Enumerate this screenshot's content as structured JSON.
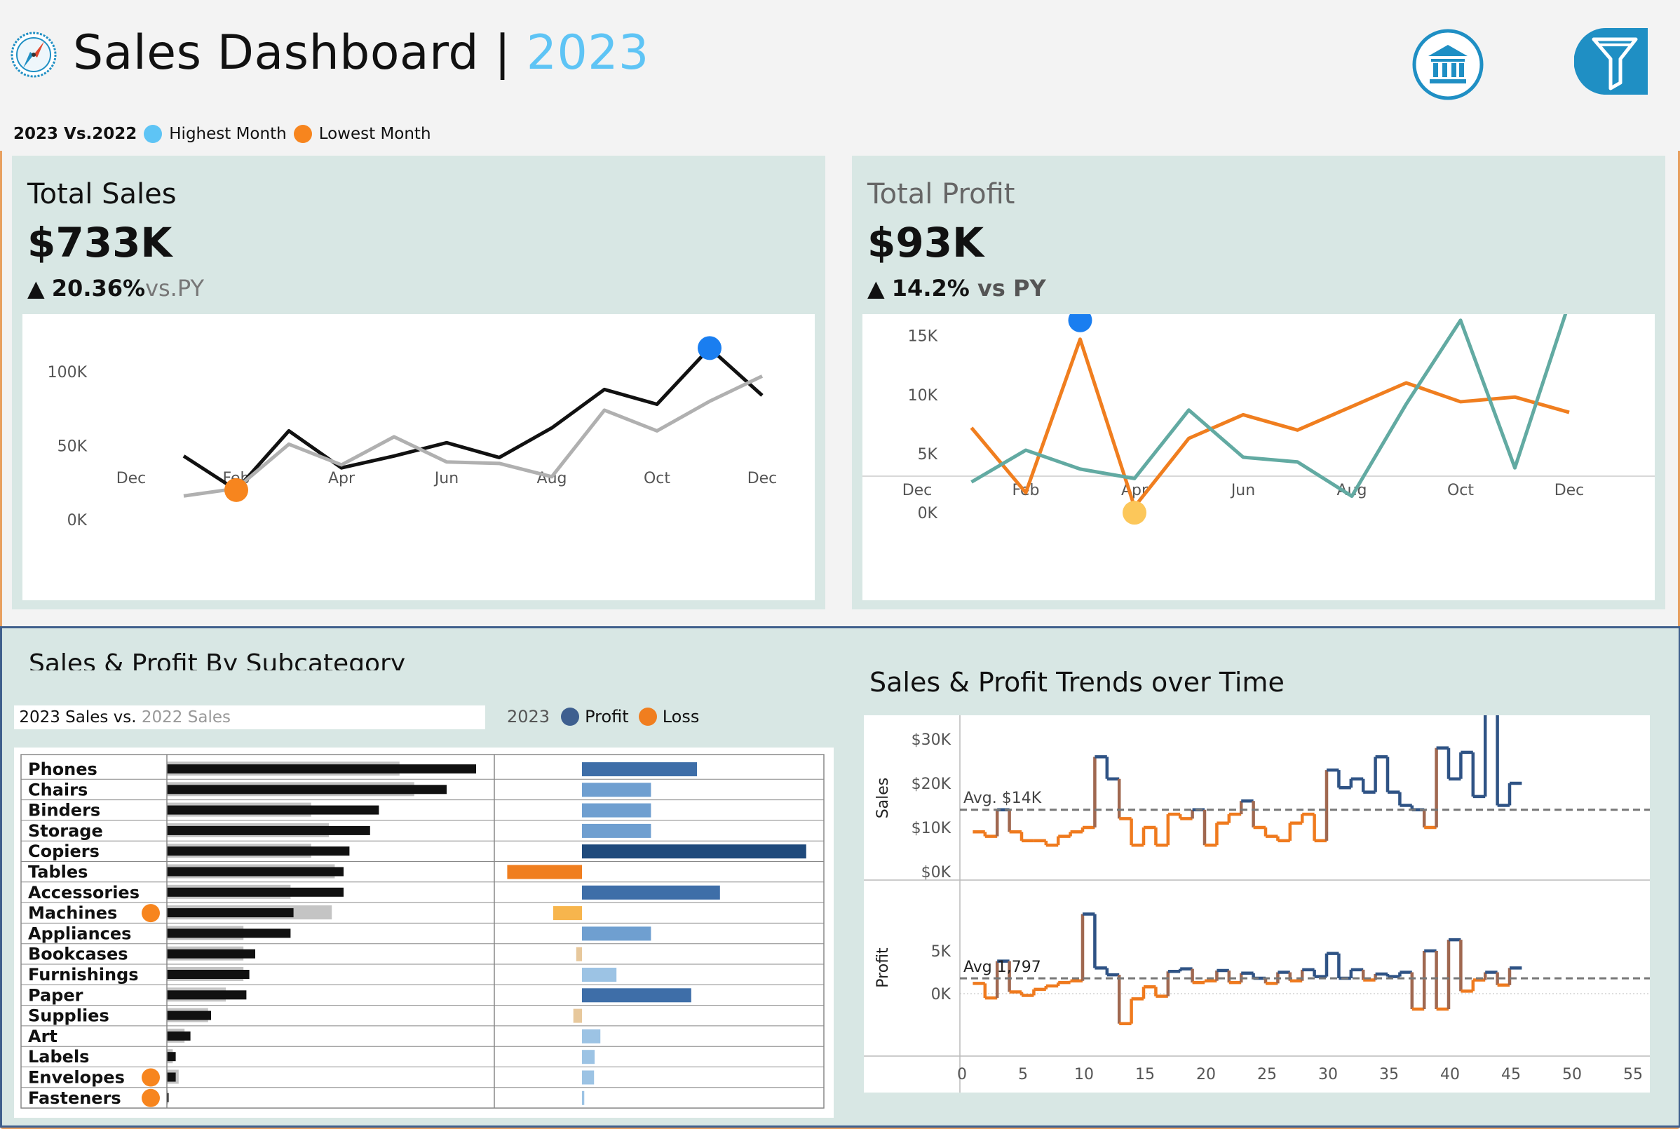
{
  "header": {
    "title": "Sales Dashboard |",
    "year": "2023",
    "legend_prefix": "2023 Vs.2022",
    "legend_high": "Highest Month",
    "legend_low": "Lowest Month",
    "icons": [
      "compass-icon",
      "bank-icon",
      "filter-icon"
    ],
    "colors": {
      "high": "#5ec4f5",
      "low": "#f7851e",
      "filter_bg": "#1f8fc4"
    }
  },
  "kpi_sales": {
    "title": "Total Sales",
    "value": "$733K",
    "arrow": "▲",
    "change": "20.36%",
    "suffix": "vs.PY"
  },
  "kpi_profit": {
    "title": "Total Profit",
    "value": "$93K",
    "arrow": "▲",
    "change": "14.2%",
    "suffix": " vs PY"
  },
  "sections": {
    "subcategory_title": "Sales & Profit By Subcategory",
    "trends_title": "Sales & Profit Trends over Time",
    "sales_legend_2023": "2023 Sales vs. ",
    "sales_legend_2022": "2022 Sales",
    "pl_year": "2023",
    "pl_profit": "Profit",
    "pl_loss": "Loss"
  },
  "chart_data": [
    {
      "type": "line",
      "name": "total-sales-monthly",
      "x_ticks": [
        "Dec",
        "Feb",
        "Apr",
        "Jun",
        "Aug",
        "Oct",
        "Dec"
      ],
      "y_ticks": [
        "0K",
        "50K",
        "100K"
      ],
      "ylim": [
        0,
        110
      ],
      "x": [
        1,
        2,
        3,
        4,
        5,
        6,
        7,
        8,
        9,
        10,
        11,
        12
      ],
      "series": [
        {
          "values": [
            43,
            20,
            60,
            35,
            43,
            52,
            42,
            62,
            88,
            78,
            116,
            84
          ],
          "color": "#111111"
        },
        {
          "values": [
            16,
            21,
            51,
            37,
            56,
            39,
            38,
            29,
            74,
            60,
            80,
            97
          ],
          "color": "#b0b0b0"
        }
      ],
      "highlight_high": {
        "x": 11,
        "y": 116
      },
      "highlight_low": {
        "x": 2,
        "y": 20
      }
    },
    {
      "type": "line",
      "name": "total-profit-monthly",
      "x_ticks": [
        "Dec",
        "Feb",
        "Apr",
        "Jun",
        "Aug",
        "Oct",
        "Dec"
      ],
      "y_ticks": [
        "0K",
        "5K",
        "10K",
        "15K"
      ],
      "ylim": [
        -1,
        17
      ],
      "x": [
        1,
        2,
        3,
        4,
        5,
        6,
        7,
        8,
        9,
        10,
        11,
        12
      ],
      "series": [
        {
          "values": [
            7.2,
            1.7,
            14.7,
            0.5,
            6.3,
            8.3,
            7.0,
            9.0,
            11.0,
            9.4,
            9.8,
            8.5
          ],
          "color": "#f07e1f"
        },
        {
          "values": [
            2.6,
            5.3,
            3.7,
            2.9,
            8.7,
            4.7,
            4.3,
            1.4,
            9.2,
            16.3,
            3.8,
            17.8
          ],
          "color": "#62aaa2"
        }
      ],
      "highlight_high": {
        "x": 3,
        "y": 16.3
      },
      "highlight_low": {
        "x": 4,
        "y": 0.0
      }
    },
    {
      "type": "bar",
      "name": "sales-profit-by-subcategory",
      "categories": [
        "Phones",
        "Chairs",
        "Binders",
        "Storage",
        "Copiers",
        "Tables",
        "Accessories",
        "Machines",
        "Appliances",
        "Bookcases",
        "Furnishings",
        "Paper",
        "Supplies",
        "Art",
        "Labels",
        "Envelopes",
        "Fasteners"
      ],
      "sales_2023": [
        105,
        95,
        72,
        69,
        62,
        60,
        60,
        43,
        42,
        30,
        28,
        27,
        15,
        8,
        3,
        3,
        0.6
      ],
      "sales_2022": [
        79,
        84,
        49,
        55,
        49,
        57,
        42,
        56,
        26,
        26,
        26,
        20,
        14,
        6,
        2,
        4,
        0.4
      ],
      "profit": [
        20,
        12,
        12,
        12,
        39,
        -13,
        24,
        -5,
        12,
        -1,
        6,
        19,
        -1.5,
        3.2,
        2.2,
        2.1,
        0.4
      ],
      "sales_flag": [
        false,
        false,
        false,
        false,
        false,
        false,
        false,
        true,
        false,
        false,
        false,
        false,
        false,
        false,
        false,
        true,
        true
      ]
    },
    {
      "type": "line",
      "name": "weekly-trends",
      "x_ticks": [
        "0",
        "5",
        "10",
        "15",
        "20",
        "25",
        "30",
        "35",
        "40",
        "45",
        "50",
        "55"
      ],
      "sales_y_ticks": [
        "$0K",
        "$10K",
        "$20K",
        "$30K"
      ],
      "sales_avg_label": "Avg. $14K",
      "sales_avg": 14,
      "sales_axis_label": "Sales",
      "sales": [
        9,
        8,
        14,
        9,
        7,
        7,
        6,
        8,
        9,
        10,
        26,
        21,
        12,
        6,
        10,
        6,
        13,
        12,
        14,
        6,
        11,
        13,
        16,
        10,
        8,
        7,
        11,
        13,
        7,
        23,
        19,
        21,
        18,
        26,
        18,
        15,
        14,
        10,
        28,
        21,
        27,
        17,
        36,
        15,
        20
      ],
      "profit_y_ticks": [
        "0K",
        "5K"
      ],
      "profit_avg_label": "Avg 1,797",
      "profit_avg": 1.797,
      "profit_axis_label": "Profit",
      "profit": [
        1.2,
        -0.5,
        3.8,
        0.2,
        -0.2,
        0.5,
        0.9,
        1.3,
        1.5,
        9.3,
        3.0,
        2.2,
        -3.5,
        -0.6,
        0.8,
        -0.3,
        2.6,
        2.9,
        1.3,
        1.5,
        2.7,
        1.3,
        2.4,
        1.8,
        1.2,
        2.5,
        1.5,
        2.8,
        2.0,
        4.7,
        1.8,
        2.8,
        1.6,
        2.3,
        2.0,
        2.5,
        -1.8,
        5.0,
        -1.8,
        6.3,
        0.3,
        1.6,
        2.5,
        1.0,
        3.0
      ]
    }
  ]
}
